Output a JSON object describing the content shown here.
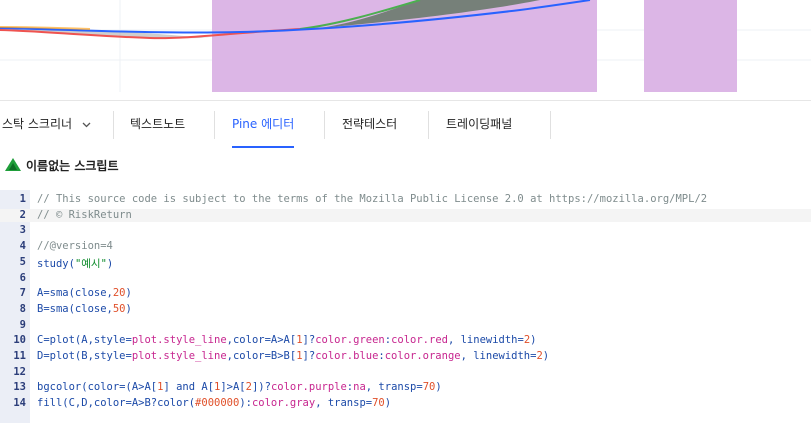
{
  "tabs": [
    {
      "label": "스탁 스크리너",
      "has_dropdown": true
    },
    {
      "label": "텍스트노트"
    },
    {
      "label": "Pine 에디터",
      "active": true
    },
    {
      "label": "전략테스터"
    },
    {
      "label": "트레이딩패널"
    }
  ],
  "script": {
    "title": "이름없는 스크립트"
  },
  "editor": {
    "lines": [
      {
        "n": "1",
        "tokens": [
          {
            "t": "// This source code is subject to the terms of the Mozilla Public License 2.0 at https://mozilla.org/MPL/2",
            "c": "com"
          }
        ]
      },
      {
        "n": "2",
        "tokens": [
          {
            "t": "// © RiskReturn",
            "c": "com"
          }
        ]
      },
      {
        "n": "3",
        "tokens": []
      },
      {
        "n": "4",
        "tokens": [
          {
            "t": "//@version=4",
            "c": "com"
          }
        ]
      },
      {
        "n": "5",
        "tokens": [
          {
            "t": "study(",
            "c": "plain"
          },
          {
            "t": "\"예시\"",
            "c": "str"
          },
          {
            "t": ")",
            "c": "plain"
          }
        ]
      },
      {
        "n": "6",
        "tokens": []
      },
      {
        "n": "7",
        "tokens": [
          {
            "t": "A=sma(close,",
            "c": "plain"
          },
          {
            "t": "20",
            "c": "num"
          },
          {
            "t": ")",
            "c": "plain"
          }
        ]
      },
      {
        "n": "8",
        "tokens": [
          {
            "t": "B=sma(close,",
            "c": "plain"
          },
          {
            "t": "50",
            "c": "num"
          },
          {
            "t": ")",
            "c": "plain"
          }
        ]
      },
      {
        "n": "9",
        "tokens": []
      },
      {
        "n": "10",
        "tokens": [
          {
            "t": "C=plot(A,style=",
            "c": "plain"
          },
          {
            "t": "plot.style_line",
            "c": "kw"
          },
          {
            "t": ",color=A>A[",
            "c": "plain"
          },
          {
            "t": "1",
            "c": "num"
          },
          {
            "t": "]?",
            "c": "plain"
          },
          {
            "t": "color.green",
            "c": "kw"
          },
          {
            "t": ":",
            "c": "plain"
          },
          {
            "t": "color.red",
            "c": "kw"
          },
          {
            "t": ", linewidth=",
            "c": "plain"
          },
          {
            "t": "2",
            "c": "num"
          },
          {
            "t": ")",
            "c": "plain"
          }
        ]
      },
      {
        "n": "11",
        "tokens": [
          {
            "t": "D=plot(B,style=",
            "c": "plain"
          },
          {
            "t": "plot.style_line",
            "c": "kw"
          },
          {
            "t": ",color=B>B[",
            "c": "plain"
          },
          {
            "t": "1",
            "c": "num"
          },
          {
            "t": "]?",
            "c": "plain"
          },
          {
            "t": "color.blue",
            "c": "kw"
          },
          {
            "t": ":",
            "c": "plain"
          },
          {
            "t": "color.orange",
            "c": "kw"
          },
          {
            "t": ", linewidth=",
            "c": "plain"
          },
          {
            "t": "2",
            "c": "num"
          },
          {
            "t": ")",
            "c": "plain"
          }
        ]
      },
      {
        "n": "12",
        "tokens": []
      },
      {
        "n": "13",
        "tokens": [
          {
            "t": "bgcolor(color=(A>A[",
            "c": "plain"
          },
          {
            "t": "1",
            "c": "num"
          },
          {
            "t": "] and A[",
            "c": "plain"
          },
          {
            "t": "1",
            "c": "num"
          },
          {
            "t": "]>A[",
            "c": "plain"
          },
          {
            "t": "2",
            "c": "num"
          },
          {
            "t": "])?",
            "c": "plain"
          },
          {
            "t": "color.purple",
            "c": "kw"
          },
          {
            "t": ":",
            "c": "plain"
          },
          {
            "t": "na",
            "c": "kw"
          },
          {
            "t": ", transp=",
            "c": "plain"
          },
          {
            "t": "70",
            "c": "num"
          },
          {
            "t": ")",
            "c": "plain"
          }
        ]
      },
      {
        "n": "14",
        "tokens": [
          {
            "t": "fill(C,D,color=A>B?color(",
            "c": "plain"
          },
          {
            "t": "#000000",
            "c": "num"
          },
          {
            "t": "):",
            "c": "plain"
          },
          {
            "t": "color.gray",
            "c": "kw"
          },
          {
            "t": ", transp=",
            "c": "plain"
          },
          {
            "t": "70",
            "c": "num"
          },
          {
            "t": ")",
            "c": "plain"
          }
        ]
      }
    ]
  },
  "colors": {
    "accent": "#2962ff",
    "highlight_band": "#dcb6e6",
    "line_red": "#ef5350",
    "line_green": "#4caf50",
    "line_blue": "#2962ff",
    "line_orange": "#ff9800",
    "fill_gray": "#9e9e9e",
    "fill_dark": "#4a6a4a",
    "logo_green": "#1f9e3a"
  }
}
